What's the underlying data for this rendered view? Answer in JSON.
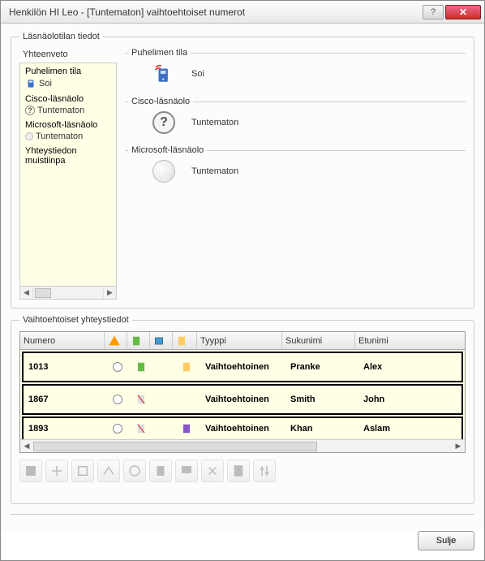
{
  "window": {
    "title": "Henkilön HI Leo - [Tuntematon] vaihtoehtoiset numerot"
  },
  "presence": {
    "group_label": "Läsnäolotilan tiedot",
    "sidebar_header": "Yhteenveto",
    "sidebar": [
      {
        "label": "Puhelimen tila",
        "value": "Soi"
      },
      {
        "label": "Cisco-läsnäolo",
        "value": "Tuntematon"
      },
      {
        "label": "Microsoft-läsnäolo",
        "value": "Tuntematon"
      },
      {
        "label": "Yhteystiedon muistiinpa",
        "value": ""
      }
    ],
    "sections": {
      "phone": {
        "legend": "Puhelimen tila",
        "status": "Soi"
      },
      "cisco": {
        "legend": "Cisco-läsnäolo",
        "status": "Tuntematon"
      },
      "ms": {
        "legend": "Microsoft-läsnäolo",
        "status": "Tuntematon"
      }
    }
  },
  "alt": {
    "group_label": "Vaihtoehtoiset yhteystiedot",
    "headers": {
      "number": "Numero",
      "type": "Tyyppi",
      "lastname": "Sukunimi",
      "firstname": "Etunimi"
    },
    "rows": [
      {
        "number": "1013",
        "type": "Vaihtoehtoinen",
        "lastname": "Pranke",
        "firstname": "Alex"
      },
      {
        "number": "1867",
        "type": "Vaihtoehtoinen",
        "lastname": "Smith",
        "firstname": "John"
      },
      {
        "number": "1893",
        "type": "Vaihtoehtoinen",
        "lastname": "Khan",
        "firstname": "Aslam"
      }
    ]
  },
  "footer": {
    "close": "Sulje"
  }
}
